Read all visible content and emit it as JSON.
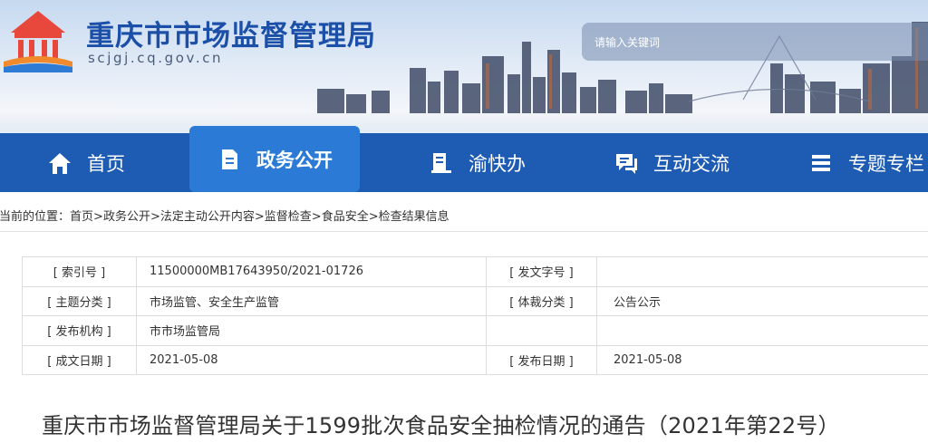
{
  "site": {
    "title": "重庆市市场监督管理局",
    "domain": "scjgj.cq.gov.cn",
    "logo_icon": "cq-building-logo-icon"
  },
  "search": {
    "placeholder": "请输入关键词"
  },
  "nav": {
    "items": [
      {
        "label": "首页",
        "icon": "home-icon",
        "active": false
      },
      {
        "label": "政务公开",
        "icon": "document-icon",
        "active": true
      },
      {
        "label": "渝快办",
        "icon": "service-book-icon",
        "active": false
      },
      {
        "label": "互动交流",
        "icon": "chat-icon",
        "active": false
      },
      {
        "label": "专题专栏",
        "icon": "stack-icon",
        "active": false
      }
    ],
    "colors": {
      "bar": "#1e5cb3",
      "active": "#2a7ad6"
    }
  },
  "breadcrumb": {
    "prefix": "您当前的位置：",
    "items": [
      "首页",
      "政务公开",
      "法定主动公开内容",
      "监督检查",
      "食品安全",
      "检查结果信息"
    ],
    "separator": ">"
  },
  "meta": {
    "rows": [
      {
        "k1": "[ 索引号 ]",
        "v1": "11500000MB17643950/2021-01726",
        "k2": "[ 发文字号 ]",
        "v2": ""
      },
      {
        "k1": "[ 主题分类 ]",
        "v1": "市场监管、安全生产监管",
        "k2": "[ 体裁分类 ]",
        "v2": "公告公示"
      },
      {
        "k1": "[ 发布机构 ]",
        "v1": "市市场监管局",
        "k2": "",
        "v2": ""
      },
      {
        "k1": "[ 成文日期 ]",
        "v1": "2021-05-08",
        "k2": "[ 发布日期 ]",
        "v2": "2021-05-08"
      }
    ]
  },
  "article": {
    "title": "重庆市市场监督管理局关于1599批次食品安全抽检情况的通告（2021年第22号）"
  }
}
